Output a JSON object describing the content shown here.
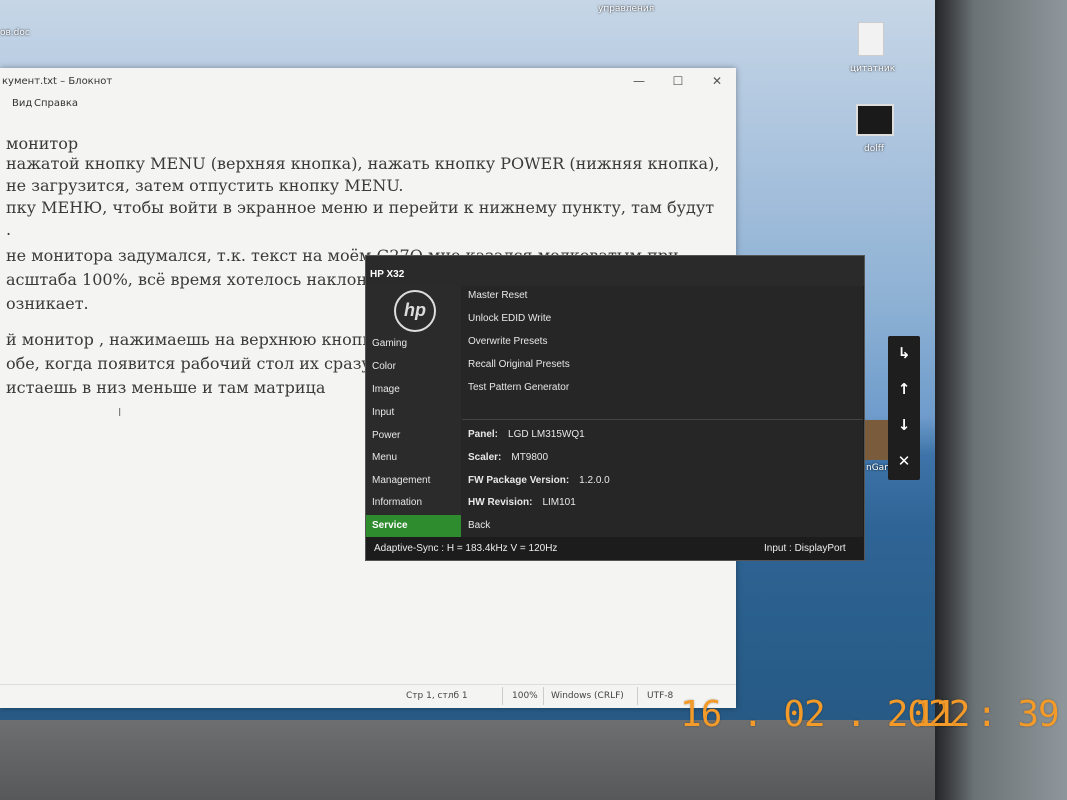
{
  "desktop": {
    "labels": {
      "top_left": "ов.doc",
      "top_center": "управления",
      "shortcut1": "цитатник",
      "shortcut2": "dolff",
      "shortcut3": "nGam"
    }
  },
  "notepad": {
    "title": "кумент.txt – Блокнот",
    "controls": {
      "minimize": "—",
      "maximize": "☐",
      "close": "✕"
    },
    "menu": [
      "Вид",
      "Справка"
    ],
    "lines": [
      "монитор",
      "нажатой кнопку MENU (верхняя кнопка), нажать кнопку POWER (нижняя кнопка),",
      "не загрузится, затем отпустить кнопку MENU.",
      "пку МЕНЮ, чтобы войти в экранное меню и перейти к нижнему пункту, там будут",
      ".",
      "не монитора задумался, т.к. текст на моём G27Q мне казался мелковатым при",
      "асштаба 100%, всё время хотелось наклонит",
      "озникает.",
      "",
      "й монитор , нажимаешь на верхнюю кнопку ,",
      "обе, когда появится рабочий стол их сразу отп",
      "истаешь в низ меньше и там матрица"
    ],
    "cursor_glyph": "I",
    "status": {
      "position": "Стр 1, стлб 1",
      "zoom": "100%",
      "line_endings": "Windows (CRLF)",
      "encoding": "UTF-8"
    }
  },
  "osd": {
    "title": "HP X32",
    "logo": "hp",
    "nav": [
      "Gaming",
      "Color",
      "Image",
      "Input",
      "Power",
      "Menu",
      "Management",
      "Information",
      "Service"
    ],
    "active_nav": "Service",
    "items": [
      "Master Reset",
      "Unlock EDID Write",
      "Overwrite Presets",
      "Recall Original Presets",
      "Test Pattern Generator"
    ],
    "info": [
      {
        "label": "Panel:",
        "value": "LGD LM315WQ1"
      },
      {
        "label": "Scaler:",
        "value": "MT9800"
      },
      {
        "label": "FW Package Version:",
        "value": "1.2.0.0"
      },
      {
        "label": "HW Revision:",
        "value": "LIM101"
      }
    ],
    "back": "Back",
    "footer_left": "Adaptive-Sync : H = 183.4kHz  V = 120Hz",
    "footer_right": "Input : DisplayPort"
  },
  "osd_buttons": [
    {
      "icon": "enter-arrow-icon",
      "glyph": "↳"
    },
    {
      "icon": "arrow-up-icon",
      "glyph": "↑"
    },
    {
      "icon": "arrow-down-icon",
      "glyph": "↓"
    },
    {
      "icon": "close-icon",
      "glyph": "✕"
    }
  ],
  "timestamp": {
    "date": "16 . 02 . 2022",
    "time": "11 : 39"
  },
  "colors": {
    "osd_active": "#2e8b2e",
    "stamp": "#f39a28"
  }
}
